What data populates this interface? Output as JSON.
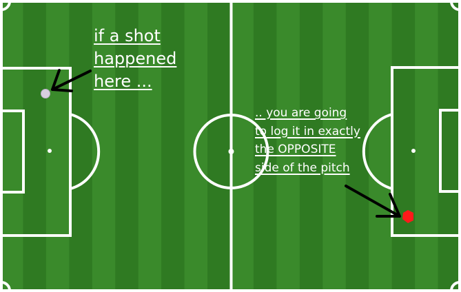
{
  "colors": {
    "stripe_light": "#3a8a2b",
    "stripe_dark": "#2f7a22",
    "line": "#ffffff",
    "arrow": "#000000",
    "shot_original": "#d8cfe0",
    "shot_logged": "#ff1a1a"
  },
  "annotations": {
    "original_note": [
      "if a shot",
      "happened",
      "here ..."
    ],
    "logged_note": [
      ".. you are going",
      "to log it in exactly",
      "the OPPOSITE",
      "side of the pitch"
    ]
  },
  "icons": [
    "arrow-icon",
    "shot-marker-icon"
  ]
}
